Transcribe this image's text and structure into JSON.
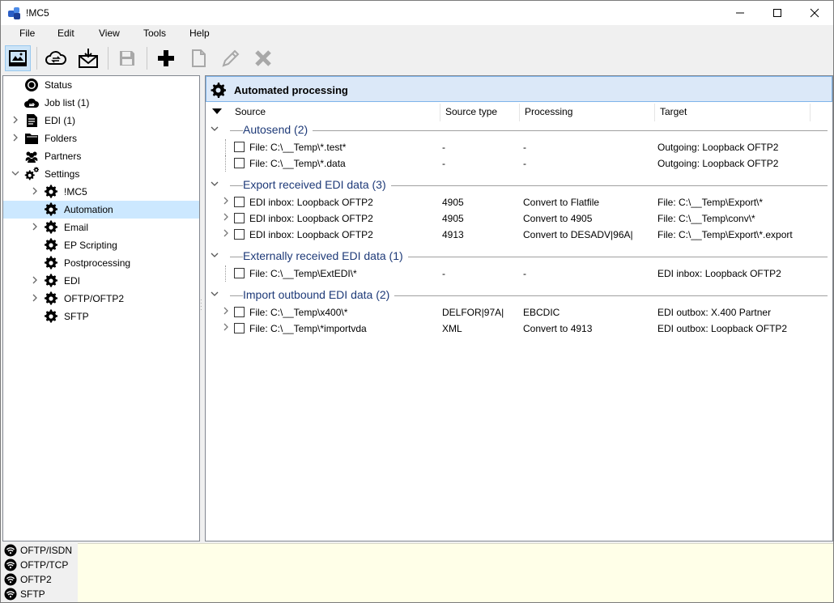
{
  "window": {
    "title": "!MC5"
  },
  "menu": {
    "items": [
      "File",
      "Edit",
      "View",
      "Tools",
      "Help"
    ]
  },
  "toolbar": {
    "buttons": [
      {
        "icon": "monitor-image-icon",
        "active": true
      },
      {
        "icon": "cloud-sync-icon"
      },
      {
        "icon": "mail-download-icon"
      },
      {
        "icon": "save-icon",
        "disabled": true
      },
      {
        "icon": "add-icon"
      },
      {
        "icon": "copy-icon",
        "disabled": true
      },
      {
        "icon": "edit-pencil-icon",
        "disabled": true
      },
      {
        "icon": "delete-x-icon",
        "disabled": true
      }
    ]
  },
  "tree": {
    "items": [
      {
        "label": "Status",
        "icon": "status-icon",
        "level": 0,
        "expander": ""
      },
      {
        "label": "Job list (1)",
        "icon": "cloud-icon",
        "level": 0,
        "expander": ""
      },
      {
        "label": "EDI (1)",
        "icon": "document-icon",
        "level": 0,
        "expander": "collapsed"
      },
      {
        "label": "Folders",
        "icon": "folder-icon",
        "level": 0,
        "expander": "collapsed"
      },
      {
        "label": "Partners",
        "icon": "partners-icon",
        "level": 0,
        "expander": ""
      },
      {
        "label": "Settings",
        "icon": "settings-gears-icon",
        "level": 0,
        "expander": "expanded"
      },
      {
        "label": "!MC5",
        "icon": "gear-icon",
        "level": 1,
        "expander": "collapsed"
      },
      {
        "label": "Automation",
        "icon": "gear-icon",
        "level": 1,
        "expander": "",
        "selected": true
      },
      {
        "label": "Email",
        "icon": "gear-icon",
        "level": 1,
        "expander": "collapsed"
      },
      {
        "label": "EP Scripting",
        "icon": "gear-icon",
        "level": 1,
        "expander": ""
      },
      {
        "label": "Postprocessing",
        "icon": "gear-icon",
        "level": 1,
        "expander": ""
      },
      {
        "label": "EDI",
        "icon": "gear-icon",
        "level": 1,
        "expander": "collapsed"
      },
      {
        "label": "OFTP/OFTP2",
        "icon": "gear-icon",
        "level": 1,
        "expander": "collapsed"
      },
      {
        "label": "SFTP",
        "icon": "gear-icon",
        "level": 1,
        "expander": ""
      }
    ]
  },
  "panel": {
    "title": "Automated processing",
    "columns": [
      "Source",
      "Source type",
      "Processing",
      "Target"
    ],
    "groups": [
      {
        "label": "Autosend (2)",
        "rows": [
          {
            "expander": false,
            "source": "File: C:\\__Temp\\*.test*",
            "source_type": "-",
            "processing": "-",
            "target": "Outgoing: Loopback OFTP2"
          },
          {
            "expander": false,
            "source": "File: C:\\__Temp\\*.data",
            "source_type": "-",
            "processing": "-",
            "target": "Outgoing: Loopback OFTP2"
          }
        ]
      },
      {
        "label": "Export received EDI data (3)",
        "rows": [
          {
            "expander": true,
            "source": "EDI inbox: Loopback OFTP2",
            "source_type": "4905",
            "processing": "Convert to Flatfile",
            "target": "File: C:\\__Temp\\Export\\*"
          },
          {
            "expander": true,
            "source": "EDI inbox: Loopback OFTP2",
            "source_type": "4905",
            "processing": "Convert to 4905",
            "target": "File: C:\\__Temp\\conv\\*"
          },
          {
            "expander": true,
            "source": "EDI inbox: Loopback OFTP2",
            "source_type": "4913",
            "processing": "Convert to DESADV|96A|",
            "target": "File: C:\\__Temp\\Export\\*.export"
          }
        ]
      },
      {
        "label": "Externally received EDI data (1)",
        "rows": [
          {
            "expander": false,
            "source": "File: C:\\__Temp\\ExtEDI\\*",
            "source_type": "-",
            "processing": "-",
            "target": "EDI inbox: Loopback OFTP2"
          }
        ]
      },
      {
        "label": "Import outbound EDI data (2)",
        "rows": [
          {
            "expander": true,
            "source": "File: C:\\__Temp\\x400\\*",
            "source_type": "DELFOR|97A|",
            "processing": "EBCDIC",
            "target": "EDI outbox: X.400 Partner"
          },
          {
            "expander": true,
            "source": "File: C:\\__Temp\\*importvda",
            "source_type": "XML",
            "processing": "Convert to 4913",
            "target": "EDI outbox: Loopback OFTP2"
          }
        ]
      }
    ]
  },
  "connections": {
    "items": [
      "OFTP/ISDN",
      "OFTP/TCP",
      "OFTP2",
      "SFTP"
    ]
  },
  "colors": {
    "header_bg": "#dbe8f8",
    "selected_bg": "#cce8ff",
    "group_text": "#1e3a78",
    "log_bg": "#ffffe8"
  }
}
